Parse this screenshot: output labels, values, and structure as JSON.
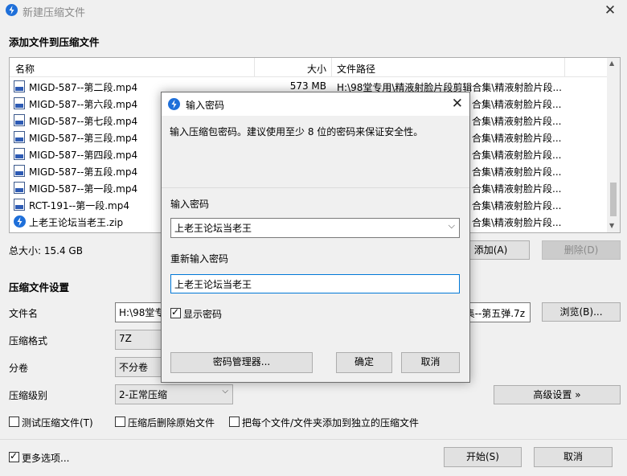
{
  "window": {
    "title": "新建压缩文件"
  },
  "add_section": {
    "title": "添加文件到压缩文件"
  },
  "file_list": {
    "columns": {
      "name": "名称",
      "size": "大小",
      "path": "文件路径"
    },
    "rows": [
      {
        "name": "MIGD-587--第二段.mp4",
        "size": "573 MB",
        "path": "H:\\98堂专用\\精液射脸片段剪辑合集\\精液射脸片段...",
        "icon": "video-file-icon"
      },
      {
        "name": "MIGD-587--第六段.mp4",
        "size": "",
        "path": "合集\\精液射脸片段...",
        "icon": "video-file-icon"
      },
      {
        "name": "MIGD-587--第七段.mp4",
        "size": "",
        "path": "合集\\精液射脸片段...",
        "icon": "video-file-icon"
      },
      {
        "name": "MIGD-587--第三段.mp4",
        "size": "",
        "path": "合集\\精液射脸片段...",
        "icon": "video-file-icon"
      },
      {
        "name": "MIGD-587--第四段.mp4",
        "size": "",
        "path": "合集\\精液射脸片段...",
        "icon": "video-file-icon"
      },
      {
        "name": "MIGD-587--第五段.mp4",
        "size": "",
        "path": "合集\\精液射脸片段...",
        "icon": "video-file-icon"
      },
      {
        "name": "MIGD-587--第一段.mp4",
        "size": "",
        "path": "合集\\精液射脸片段...",
        "icon": "video-file-icon"
      },
      {
        "name": "RCT-191--第一段.mp4",
        "size": "",
        "path": "合集\\精液射脸片段...",
        "icon": "video-file-icon"
      },
      {
        "name": "上老王论坛当老王.zip",
        "size": "",
        "path": "合集\\精液射脸片段...",
        "icon": "zip-file-icon"
      }
    ]
  },
  "total_size": "总大小: 15.4 GB",
  "buttons": {
    "add": "添加(A)",
    "delete": "删除(D)",
    "browse": "浏览(B)...",
    "advanced": "高级设置 »",
    "start": "开始(S)",
    "cancel": "取消"
  },
  "settings": {
    "title": "压缩文件设置",
    "filename_label": "文件名",
    "filename_value_left": "H:\\98堂专",
    "filename_value_right": "集--第五弹.7z",
    "format_label": "压缩格式",
    "format_value": "7Z",
    "volume_label": "分卷",
    "volume_value": "不分卷",
    "level_label": "压缩级别",
    "level_value": "2-正常压缩"
  },
  "options": {
    "test": "测试压缩文件(T)",
    "delete_after": "压缩后删除原始文件",
    "separate": "把每个文件/文件夹添加到独立的压缩文件",
    "more": "更多选项..."
  },
  "dialog": {
    "title": "输入密码",
    "description": "输入压缩包密码。建议使用至少 8 位的密码来保证安全性。",
    "password_label": "输入密码",
    "password_value": "上老王论坛当老王",
    "confirm_label": "重新输入密码",
    "confirm_value": "上老王论坛当老王",
    "show_password": "显示密码",
    "manager_button": "密码管理器...",
    "ok_button": "确定",
    "cancel_button": "取消"
  },
  "colors": {
    "accent": "#1e6fd9",
    "focus_border": "#0078d7"
  }
}
